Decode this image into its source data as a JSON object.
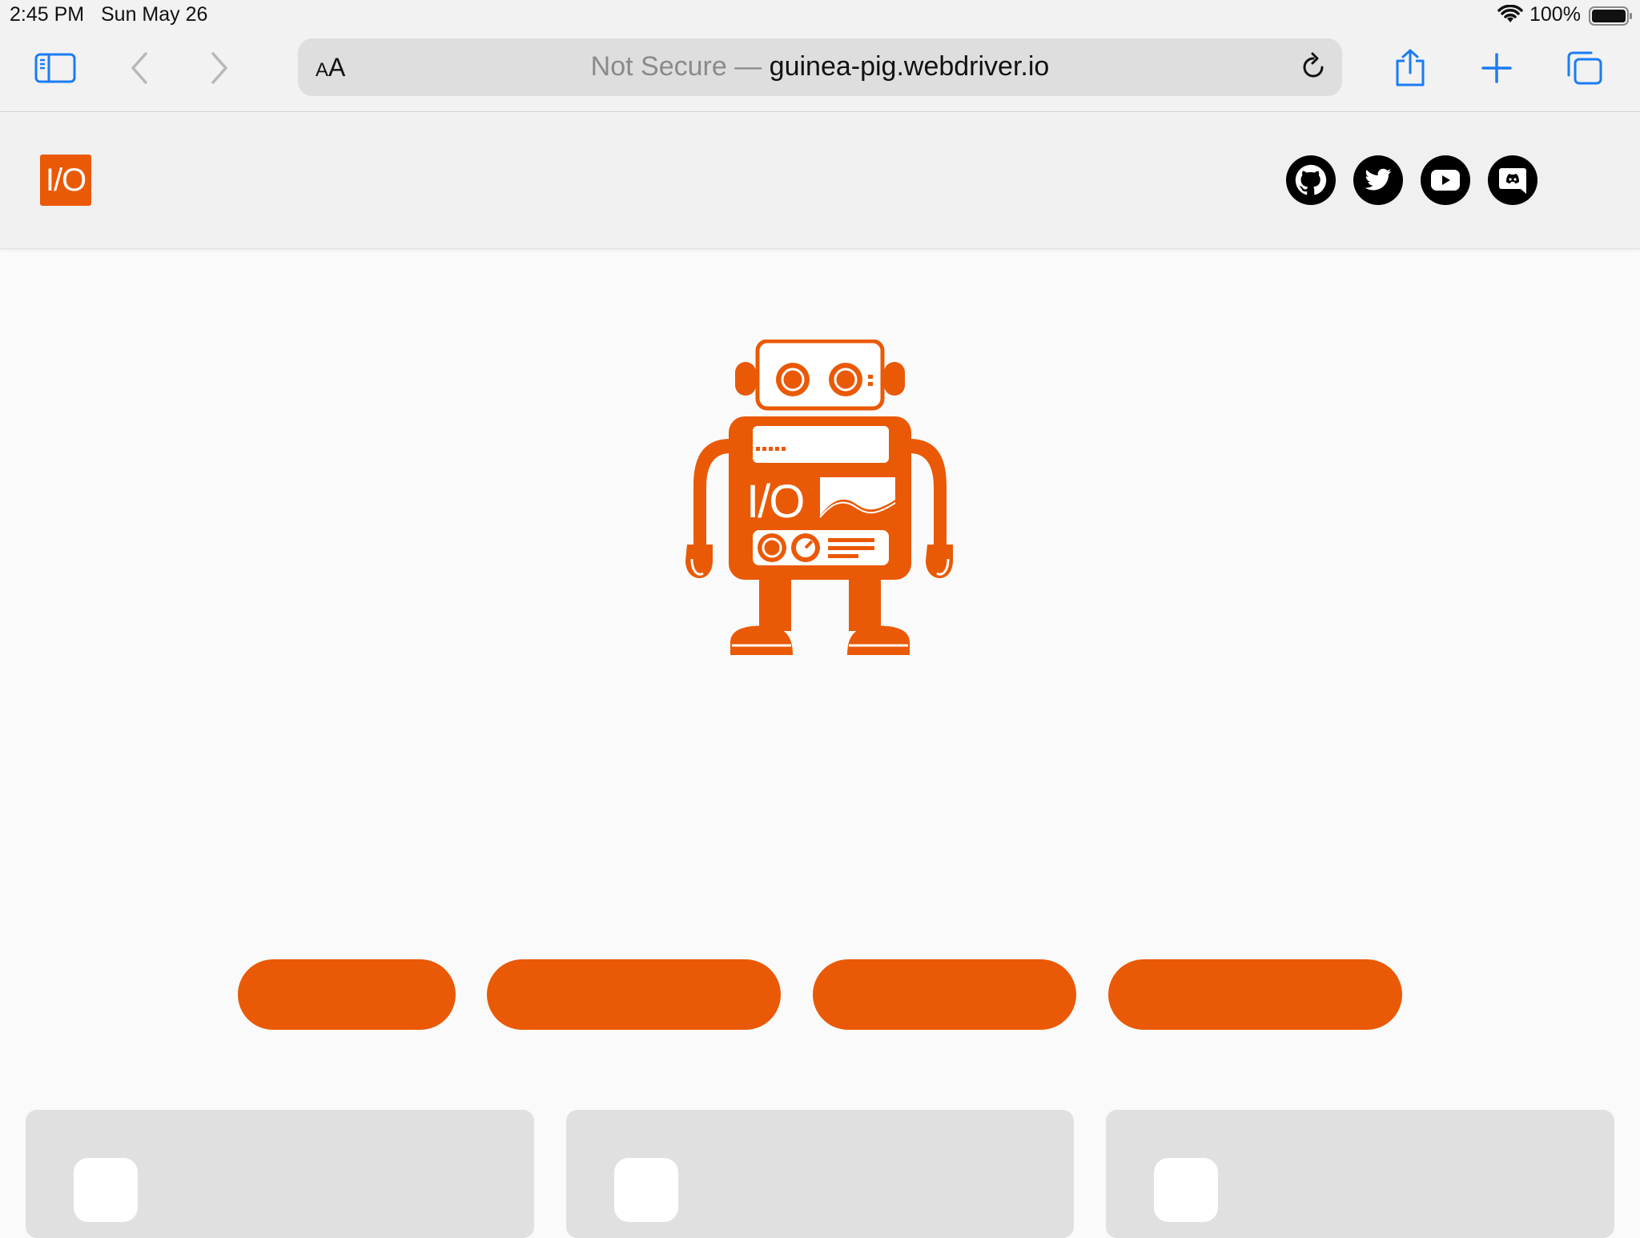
{
  "status_bar": {
    "time": "2:45 PM",
    "date": "Sun May 26",
    "battery": "100%"
  },
  "browser": {
    "aa_small": "A",
    "aa_large": "A",
    "url_prefix": "Not Secure —",
    "url_host": "guinea-pig.webdriver.io",
    "icons": [
      "sidebar-icon",
      "back-icon",
      "forward-icon",
      "reload-icon",
      "share-icon",
      "new-tab-icon",
      "tabs-icon"
    ],
    "accent_color": "#1a7cf5"
  },
  "site": {
    "logo_text": "I/O",
    "brand_color": "#ea5906",
    "social_links": [
      "github-icon",
      "twitter-icon",
      "youtube-icon",
      "discord-icon"
    ]
  },
  "hero": {
    "robot_icon": "robot-illustration"
  }
}
